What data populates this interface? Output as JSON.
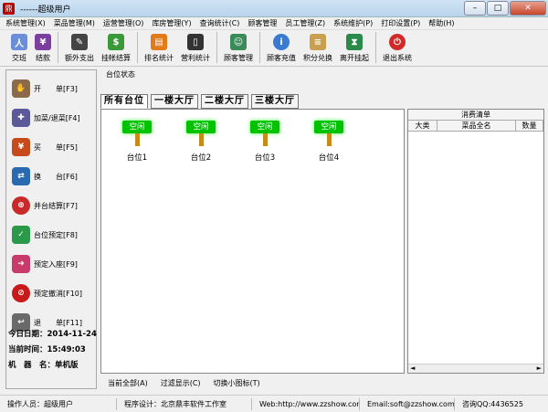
{
  "window": {
    "title": "------超级用户",
    "minimize": "–",
    "maximize": "□",
    "close": "✕"
  },
  "menu": [
    "系统管理(X)",
    "菜品管理(M)",
    "运营管理(O)",
    "库房管理(Y)",
    "查询统计(C)",
    "顾客管理",
    "员工管理(Z)",
    "系统维护(P)",
    "打印设置(P)",
    "帮助(H)"
  ],
  "toolbar": [
    {
      "label": "交班",
      "icon": "people-icon",
      "color": "#6a8ed8"
    },
    {
      "label": "结款",
      "icon": "register-icon",
      "color": "#7b3fa0"
    },
    {
      "label": "额外支出",
      "icon": "pen-icon",
      "color": "#444"
    },
    {
      "label": "挂帐结算",
      "icon": "money-icon",
      "color": "#3a9a3a"
    },
    {
      "label": "排名统计",
      "icon": "chart-icon",
      "color": "#e07a1a"
    },
    {
      "label": "营利统计",
      "icon": "phone-icon",
      "color": "#333"
    },
    {
      "label": "顾客管理",
      "icon": "users-icon",
      "color": "#3a8a5a"
    },
    {
      "label": "顾客充值",
      "icon": "info-icon",
      "color": "#3a7ad0"
    },
    {
      "label": "积分兑换",
      "icon": "scroll-icon",
      "color": "#c9a050"
    },
    {
      "label": "离开挂起",
      "icon": "hourglass-icon",
      "color": "#2a8a4a"
    },
    {
      "label": "退出系统",
      "icon": "power-icon",
      "color": "#d02a2a"
    }
  ],
  "left_buttons": [
    {
      "label": "开　　单[F3]",
      "icon": "open-order-icon",
      "color": "#8a6a4a"
    },
    {
      "label": "加菜/退菜[F4]",
      "icon": "add-dish-icon",
      "color": "#5a5a9a"
    },
    {
      "label": "买　　单[F5]",
      "icon": "pay-icon",
      "color": "#c84a1a"
    },
    {
      "label": "换　　台[F6]",
      "icon": "swap-icon",
      "color": "#2a6ab0"
    },
    {
      "label": "并台结算[F7]",
      "icon": "merge-icon",
      "color": "#c82a2a"
    },
    {
      "label": "台位预定[F8]",
      "icon": "reserve-icon",
      "color": "#2a9a4a"
    },
    {
      "label": "预定入座[F9]",
      "icon": "seat-icon",
      "color": "#c83a6a"
    },
    {
      "label": "预定撤消[F10]",
      "icon": "cancel-icon",
      "color": "#c81a1a"
    },
    {
      "label": "退　　单[F11]",
      "icon": "return-icon",
      "color": "#6a6a6a"
    }
  ],
  "info": {
    "date": "今日日期：2014-11-24",
    "time": "当前时间：15:49:03",
    "machine": "机　器　名：单机版"
  },
  "status_label": "台位状态",
  "tabs": [
    "所有台位",
    "一楼大厅",
    "二楼大厅",
    "三楼大厅"
  ],
  "tables": [
    {
      "status": "空闲",
      "name": "台位1"
    },
    {
      "status": "空闲",
      "name": "台位2"
    },
    {
      "status": "空闲",
      "name": "台位3"
    },
    {
      "status": "空闲",
      "name": "台位4"
    }
  ],
  "bottom_actions": [
    "当前全部(A)",
    "过滤显示(C)",
    "切换小图标(T)"
  ],
  "consumption": {
    "title": "消费清单",
    "columns": [
      "大类",
      "菜品全名",
      "数量"
    ]
  },
  "status_bar": [
    "操作人员：超级用户",
    "程序设计：北京鼎丰软件工作室",
    "Web:http://www.zzshow.com",
    "Email:soft@zzshow.com",
    "咨询QQ:4436525"
  ]
}
